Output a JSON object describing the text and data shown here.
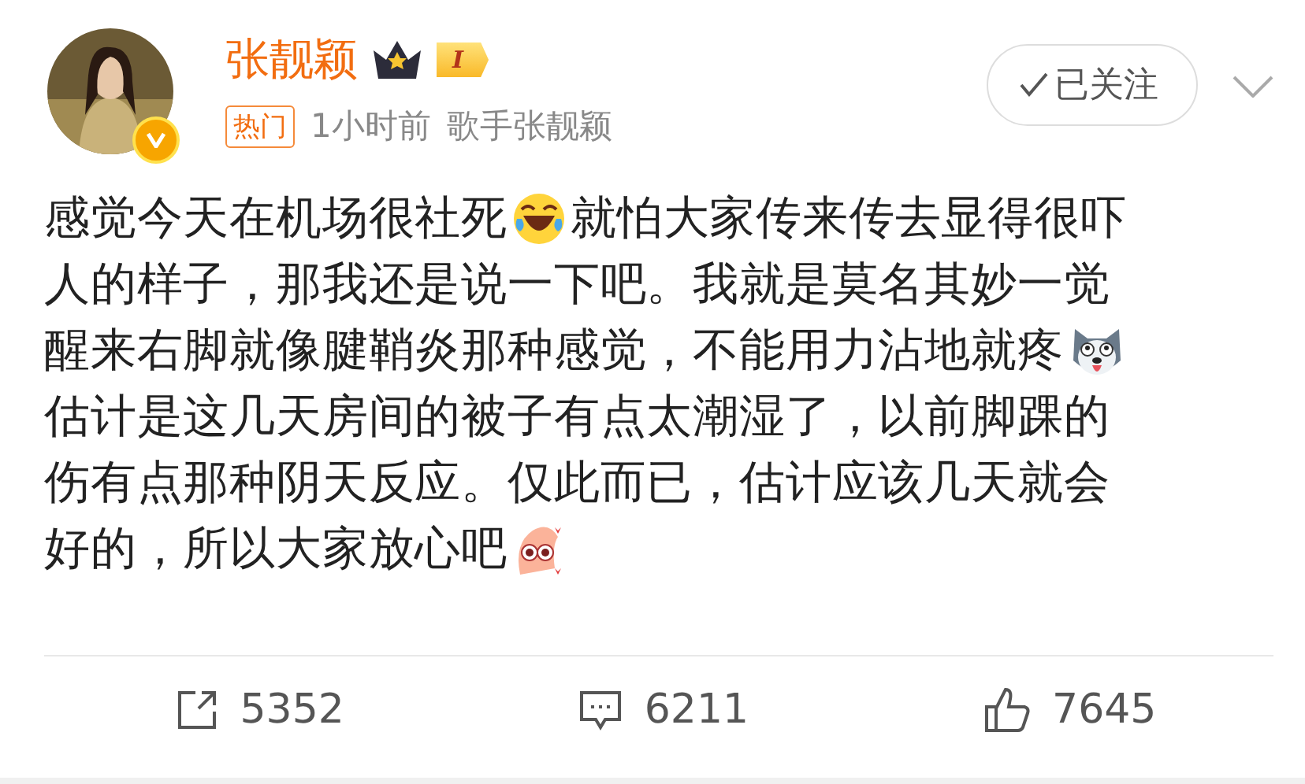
{
  "post": {
    "author": "张靓颖",
    "verified": true,
    "level_badge": "I",
    "tag": "热门",
    "time": "1小时前",
    "source": "歌手张靓颖",
    "followed": true,
    "follow_label": "已关注",
    "lines": [
      [
        {
          "kind": "text",
          "text": "感觉今天在机场很社死"
        },
        {
          "kind": "emoji"
        },
        {
          "kind": "text",
          "text": "就怕大家传来传去显得很吓"
        }
      ],
      [
        {
          "kind": "text",
          "text": "人的样子，那我还是说一下吧。我就是莫名其妙一觉"
        }
      ],
      [
        {
          "kind": "text",
          "text": "醒来右脚就像腱鞘炎那种感觉，不能用力沾地就疼"
        },
        {
          "kind": "emoji"
        }
      ],
      [
        {
          "kind": "text",
          "text": "估计是这几天房间的被子有点太潮湿了，以前脚踝的"
        }
      ],
      [
        {
          "kind": "text",
          "text": "伤有点那种阴天反应。仅此而已，估计应该几天就会"
        }
      ],
      [
        {
          "kind": "text",
          "text": "好的，所以大家放心吧"
        },
        {
          "kind": "emoji"
        }
      ]
    ]
  },
  "actions": [
    {
      "kind": "repost",
      "count": "5352"
    },
    {
      "kind": "comment",
      "count": "6211"
    },
    {
      "kind": "like",
      "count": "7645"
    }
  ]
}
